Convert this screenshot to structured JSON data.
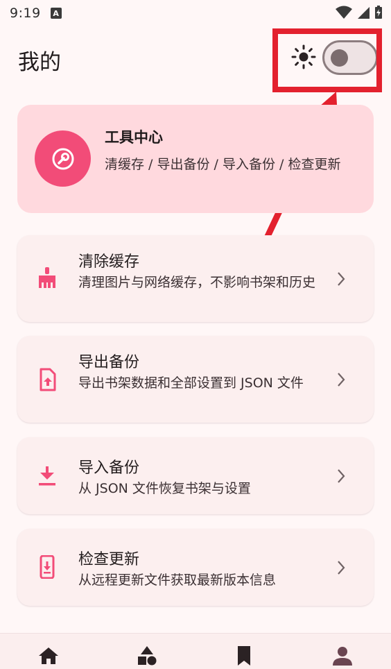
{
  "status_bar": {
    "time": "9:19",
    "badge": "A"
  },
  "header": {
    "title": "我的"
  },
  "theme_toggle": {
    "icon": "sun-icon",
    "state": "off"
  },
  "tool_center": {
    "title": "工具中心",
    "subtitle": "清缓存 / 导出备份 / 导入备份 / 检查更新",
    "icon": "wrench-icon"
  },
  "items": [
    {
      "title": "清除缓存",
      "desc": "清理图片与网络缓存，不影响书架和历史",
      "icon": "broom-icon"
    },
    {
      "title": "导出备份",
      "desc": "导出书架数据和全部设置到 JSON 文件",
      "icon": "file-upload-icon"
    },
    {
      "title": "导入备份",
      "desc": "从 JSON 文件恢复书架与设置",
      "icon": "download-icon"
    },
    {
      "title": "检查更新",
      "desc": "从远程更新文件获取最新版本信息",
      "icon": "phone-update-icon"
    }
  ],
  "bottom_nav": [
    "home-icon",
    "shapes-icon",
    "bookmark-icon",
    "person-icon"
  ],
  "colors": {
    "accent": "#f24c78",
    "tool_card_bg": "#ffd9de",
    "card_bg": "#fcefef",
    "annotation_red": "#e3212e"
  }
}
